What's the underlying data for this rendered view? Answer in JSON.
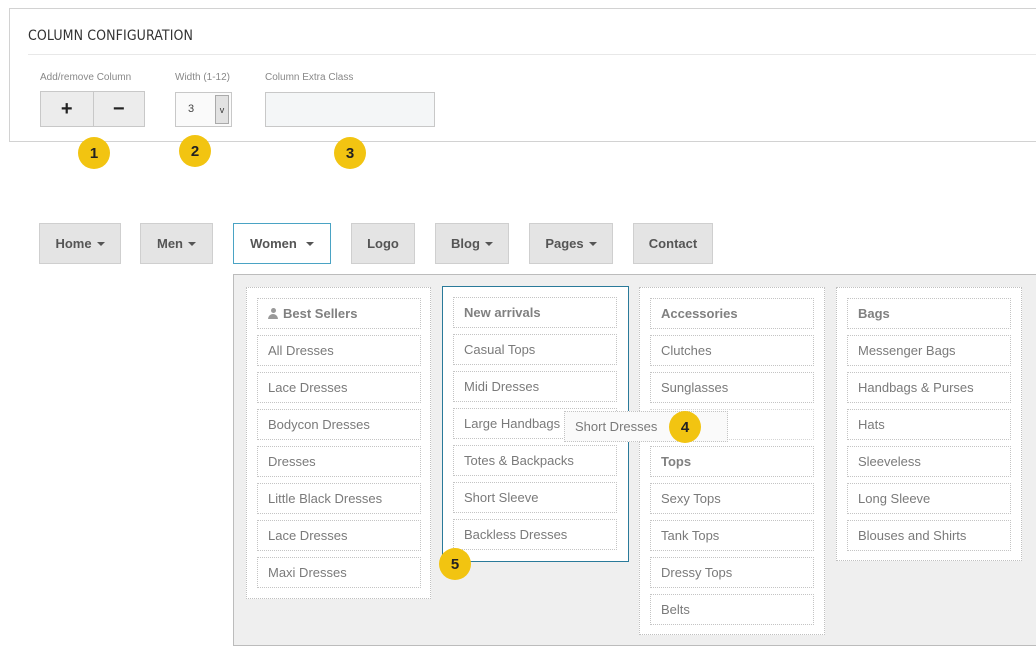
{
  "config": {
    "title": "COLUMN CONFIGURATION",
    "add_remove_label": "Add/remove Column",
    "add_button": "+",
    "remove_button": "−",
    "width_label": "Width (1-12)",
    "width_value": "3",
    "width_arrow": "v",
    "extra_class_label": "Column Extra Class",
    "extra_class_value": ""
  },
  "markers": [
    "1",
    "2",
    "3",
    "4",
    "5"
  ],
  "nav": {
    "items": [
      {
        "label": "Home"
      },
      {
        "label": "Men"
      },
      {
        "label": "Women"
      },
      {
        "label": "Logo"
      },
      {
        "label": "Blog"
      },
      {
        "label": "Pages"
      },
      {
        "label": "Contact"
      }
    ]
  },
  "mega_menu": {
    "columns": [
      {
        "items": [
          "Best Sellers",
          "All Dresses",
          "Lace Dresses",
          "Bodycon Dresses",
          "Dresses",
          "Little Black Dresses",
          "Lace Dresses",
          "Maxi Dresses"
        ]
      },
      {
        "items": [
          "New arrivals",
          "Casual Tops",
          "Midi Dresses",
          "Large Handbags",
          "Totes & Backpacks",
          "Short Sleeve",
          "Backless Dresses"
        ]
      },
      {
        "items": [
          "Accessories",
          "Clutches",
          "Sunglasses",
          "",
          "Tops",
          "Sexy Tops",
          "Tank Tops",
          "Dressy Tops",
          "Belts"
        ]
      },
      {
        "items": [
          "Bags",
          "Messenger Bags",
          "Handbags & Purses",
          "Hats",
          "Sleeveless",
          "Long Sleeve",
          "Blouses and Shirts"
        ]
      }
    ],
    "dragging_item": "Short Dresses"
  },
  "colors": {
    "marker": "#f2c411",
    "active_border": "#4aa3c4",
    "selected_column_border": "#2a7a9a"
  }
}
